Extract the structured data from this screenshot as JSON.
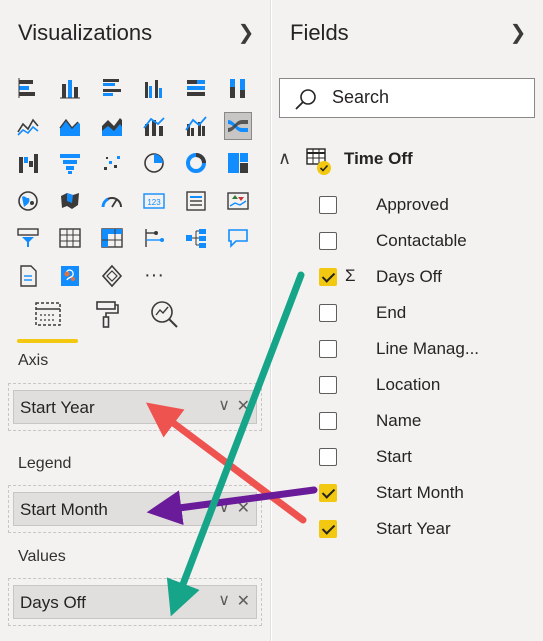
{
  "visualizations": {
    "title": "Visualizations",
    "collapse_icon": "chevron-right-icon",
    "icons": [
      "stacked-bar-chart-icon",
      "stacked-column-chart-icon",
      "clustered-bar-chart-icon",
      "clustered-column-chart-icon",
      "100-stacked-bar-chart-icon",
      "100-stacked-column-chart-icon",
      "line-chart-icon",
      "area-chart-icon",
      "stacked-area-chart-icon",
      "line-and-stacked-column-chart-icon",
      "line-and-clustered-column-chart-icon",
      "ribbon-chart-icon",
      "waterfall-chart-icon",
      "funnel-icon",
      "scatter-chart-icon",
      "pie-chart-icon",
      "donut-chart-icon",
      "treemap-icon",
      "map-icon",
      "filled-map-icon",
      "gauge-icon",
      "card-icon",
      "multi-row-card-icon",
      "kpi-icon",
      "slicer-icon",
      "table-icon",
      "matrix-icon",
      "key-influencers-icon",
      "decomposition-tree-icon",
      "qa-icon",
      "paginated-report-icon",
      "arcgis-map-icon",
      "power-apps-icon",
      "more-visuals-icon"
    ],
    "more_label": "···",
    "tabs": [
      "fields-tab-icon",
      "format-paint-roller-icon",
      "analytics-magnifier-icon"
    ],
    "wells": [
      {
        "label": "Axis",
        "value": "Start Year"
      },
      {
        "label": "Legend",
        "value": "Start Month"
      },
      {
        "label": "Values",
        "value": "Days Off"
      }
    ],
    "chevron_glyph": "∨",
    "remove_glyph": "✕"
  },
  "fields": {
    "title": "Fields",
    "collapse_icon": "chevron-right-icon",
    "search_placeholder": "Search",
    "table": {
      "name": "Time Off",
      "expanded": true,
      "icon": "table-icon"
    },
    "items": [
      {
        "name": "Approved",
        "checked": false,
        "sigma": false
      },
      {
        "name": "Contactable",
        "checked": false,
        "sigma": false
      },
      {
        "name": "Days Off",
        "checked": true,
        "sigma": true
      },
      {
        "name": "End",
        "checked": false,
        "sigma": false
      },
      {
        "name": "Line Manag...",
        "checked": false,
        "sigma": false
      },
      {
        "name": "Location",
        "checked": false,
        "sigma": false
      },
      {
        "name": "Name",
        "checked": false,
        "sigma": false
      },
      {
        "name": "Start",
        "checked": false,
        "sigma": false
      },
      {
        "name": "Start Month",
        "checked": true,
        "sigma": false
      },
      {
        "name": "Start Year",
        "checked": true,
        "sigma": false
      }
    ]
  },
  "colors": {
    "accent_yellow": "#f2c811",
    "arrow_red": "#ef5350",
    "arrow_purple": "#6a1b9a",
    "arrow_teal": "#17a589",
    "icon_blue": "#118dff",
    "icon_dark": "#3b3a39"
  },
  "annotations": {
    "arrows": [
      {
        "name": "red-arrow",
        "from": "Start Year field",
        "to": "Axis well"
      },
      {
        "name": "purple-arrow",
        "from": "Start Month field",
        "to": "Legend well"
      },
      {
        "name": "teal-arrow",
        "from": "Days Off field",
        "to": "Values well"
      }
    ]
  }
}
